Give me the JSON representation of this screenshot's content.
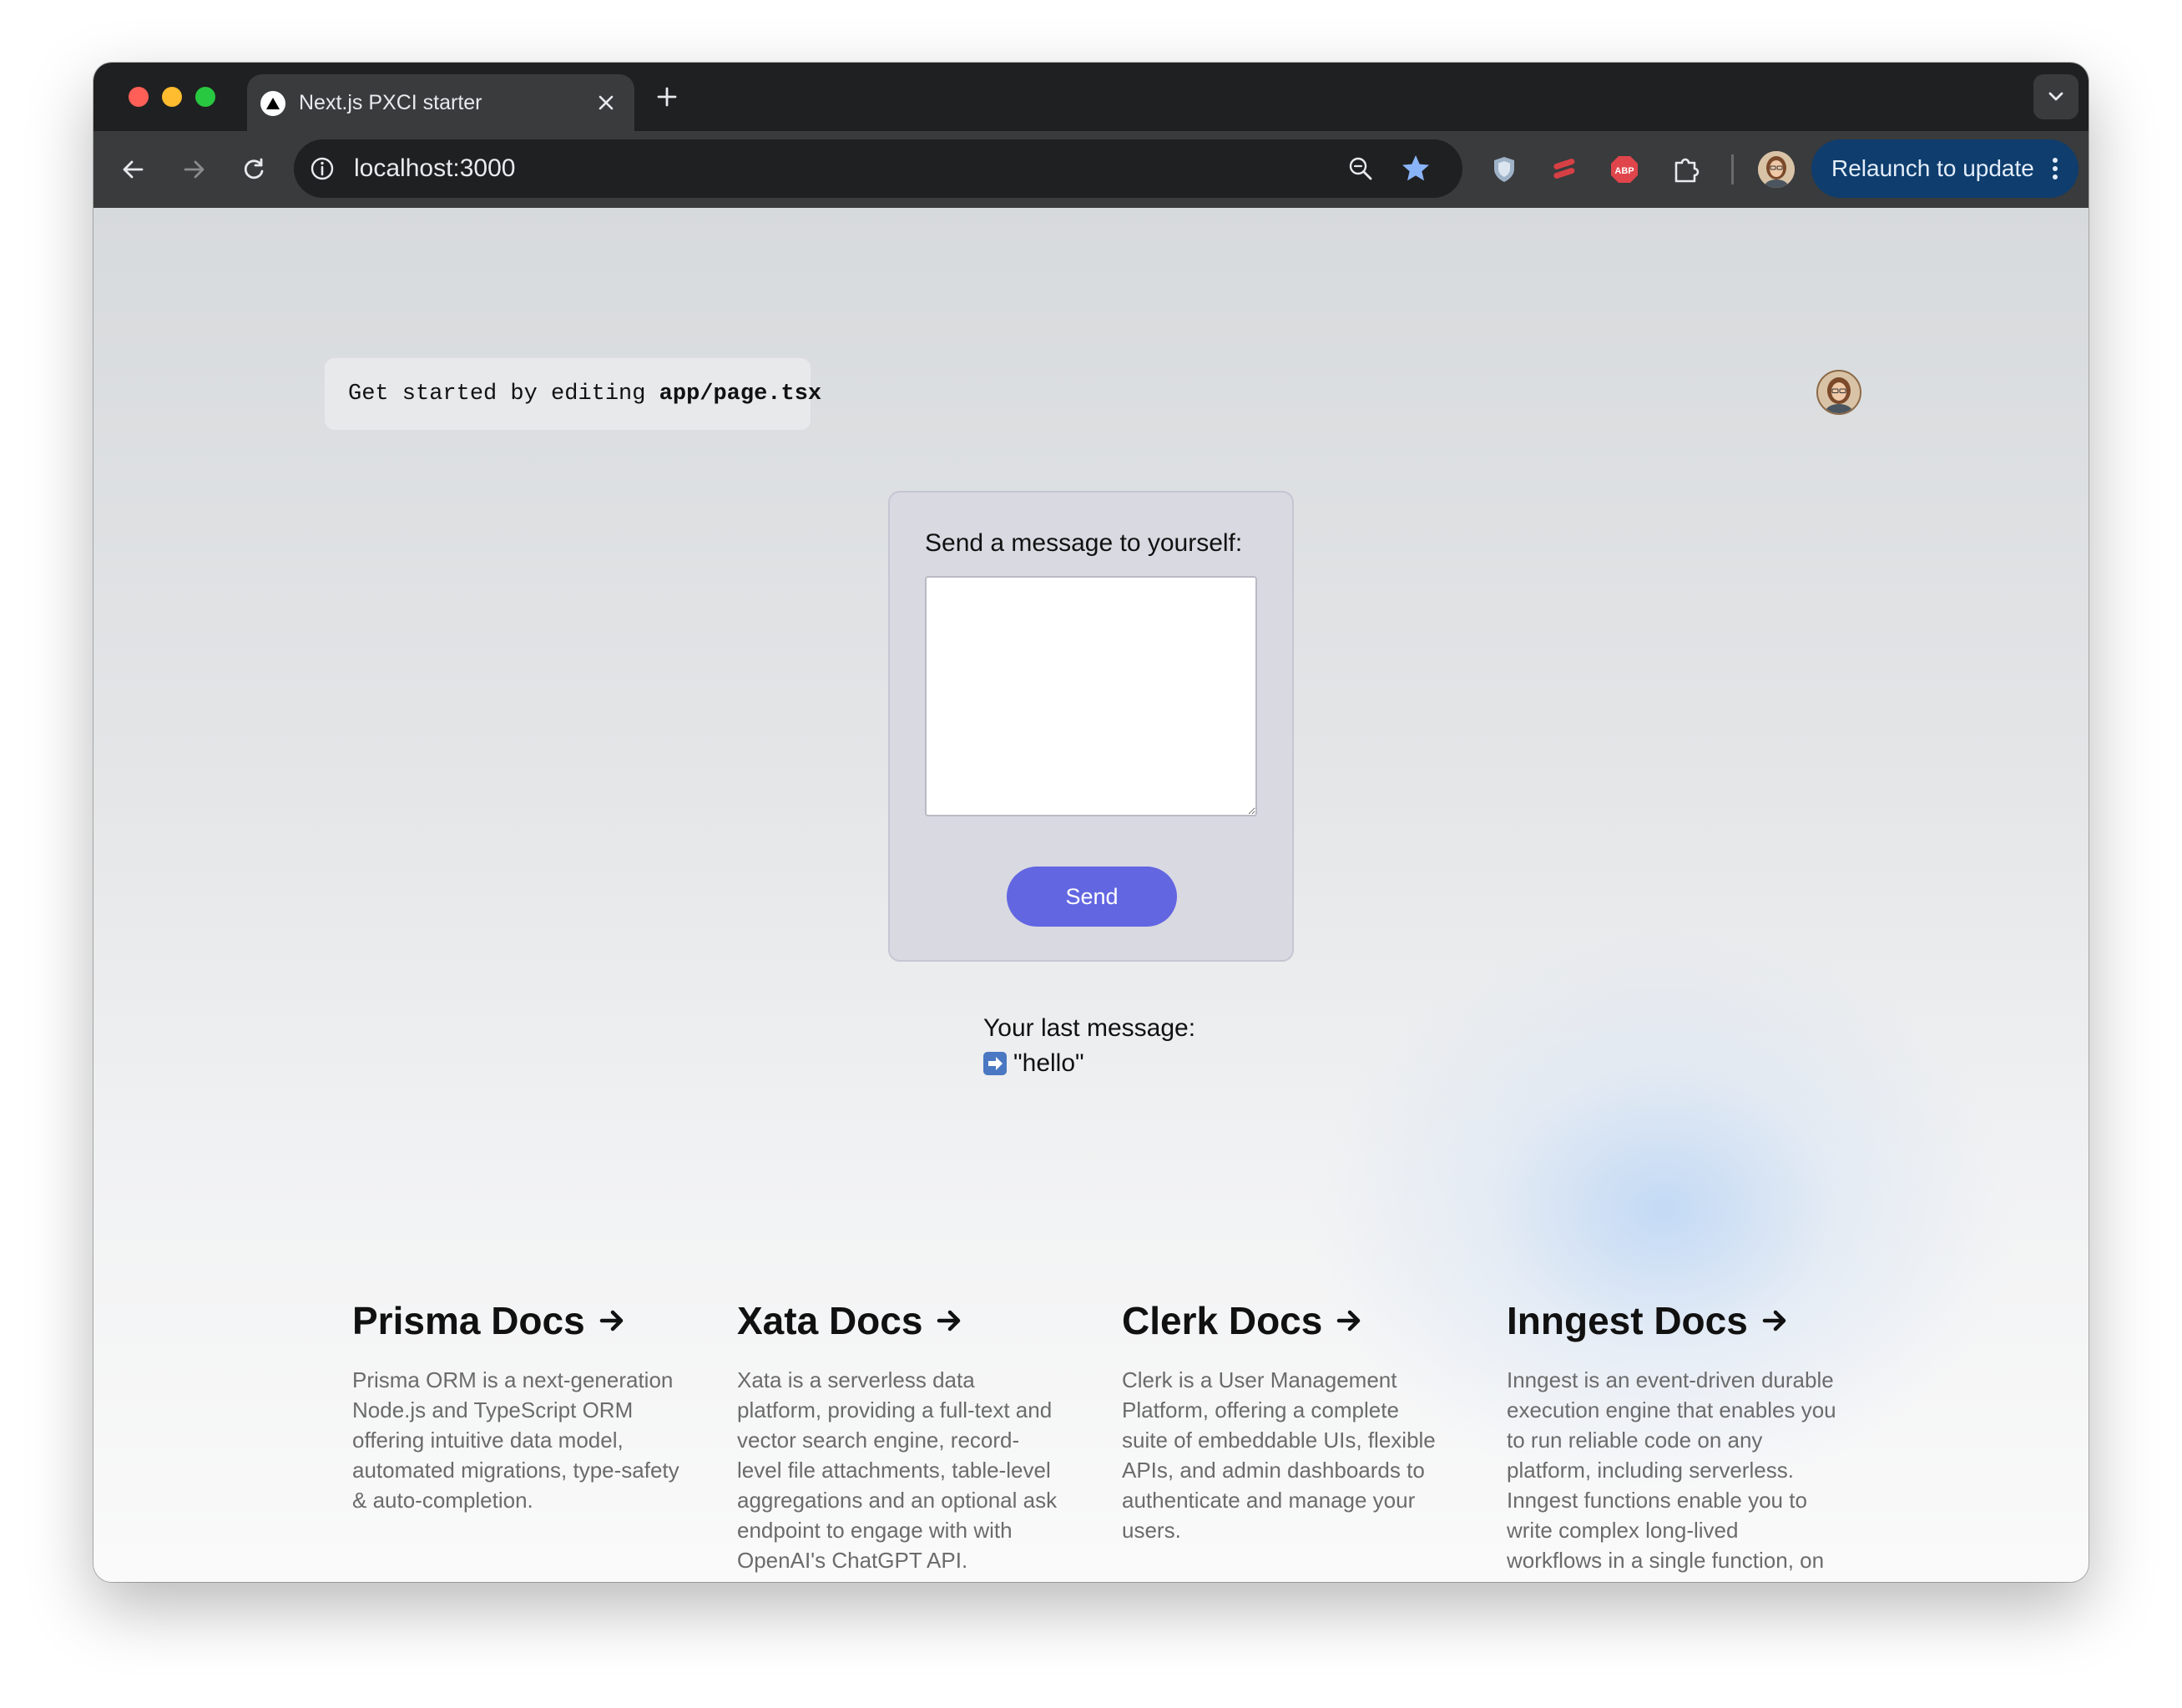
{
  "browser": {
    "tab_title": "Next.js PXCI starter",
    "url": "localhost:3000",
    "relaunch_label": "Relaunch to update"
  },
  "page": {
    "getstarted_prefix": "Get started by editing ",
    "getstarted_file": "app/page.tsx",
    "form_label": "Send a message to yourself:",
    "message_value": "",
    "send_label": "Send",
    "last_message_label": "Your last message:",
    "last_message_value": "\"hello\""
  },
  "docs": [
    {
      "title": "Prisma Docs",
      "text": "Prisma ORM is a next-generation Node.js and TypeScript ORM offering intuitive data model, automated migrations, type-safety & auto-completion."
    },
    {
      "title": "Xata Docs",
      "text": "Xata is a serverless data platform, providing a full-text and vector search engine, record-level file attachments, table-level aggregations and an optional ask endpoint to engage with with OpenAI's ChatGPT API."
    },
    {
      "title": "Clerk Docs",
      "text": "Clerk is a User Management Platform, offering a complete suite of embeddable UIs, flexible APIs, and admin dashboards to authenticate and manage your users."
    },
    {
      "title": "Inngest Docs",
      "text": "Inngest is an event-driven durable execution engine that enables you to run reliable code on any platform, including serverless. Inngest functions enable you to write complex long-lived workflows in a single function, on any platform."
    }
  ],
  "colors": {
    "accent": "#6366e1",
    "relaunch_bg": "#0e3d6e",
    "star": "#8ab4f8"
  }
}
